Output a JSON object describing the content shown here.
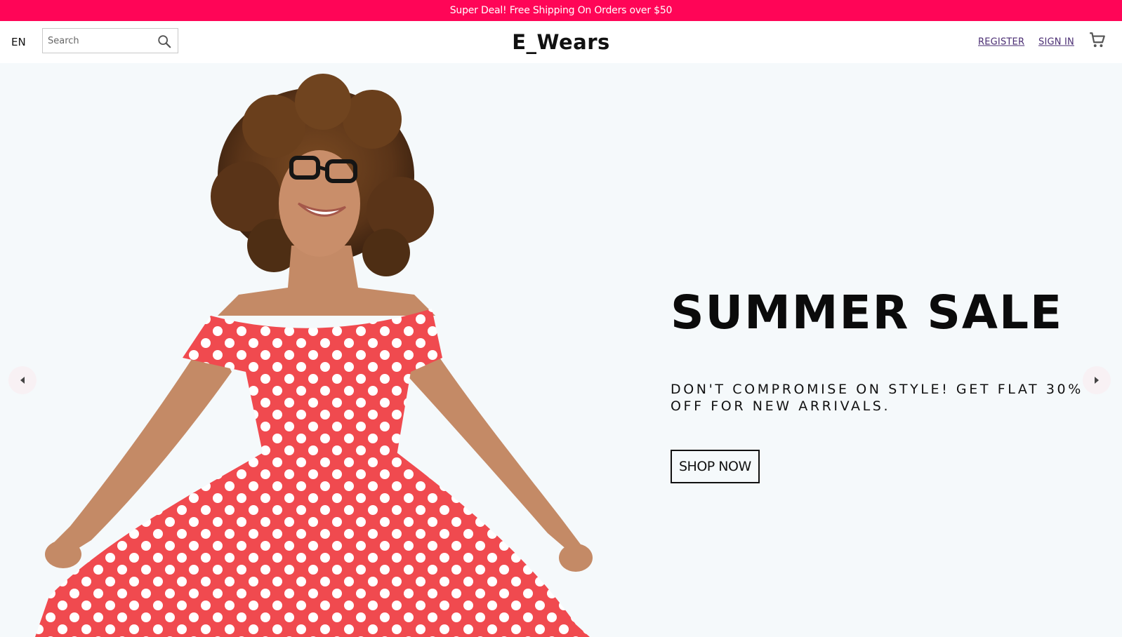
{
  "announcement": "Super Deal! Free Shipping On Orders over $50",
  "header": {
    "language": "EN",
    "search_placeholder": "Search",
    "logo": "E_Wears",
    "register": "REGISTER",
    "sign_in": "SIGN IN"
  },
  "hero": {
    "title": "SUMMER SALE",
    "subtitle": "DON'T COMPROMISE ON STYLE! GET FLAT 30% OFF FOR NEW ARRIVALS.",
    "button": "SHOP NOW"
  },
  "colors": {
    "announcement_bg": "#ff0557",
    "hero_bg": "#f5f9fb",
    "link": "#4a2d73",
    "dress": "#f04a4f"
  },
  "icons": [
    "search-icon",
    "cart-icon",
    "arrow-left-icon",
    "arrow-right-icon"
  ]
}
